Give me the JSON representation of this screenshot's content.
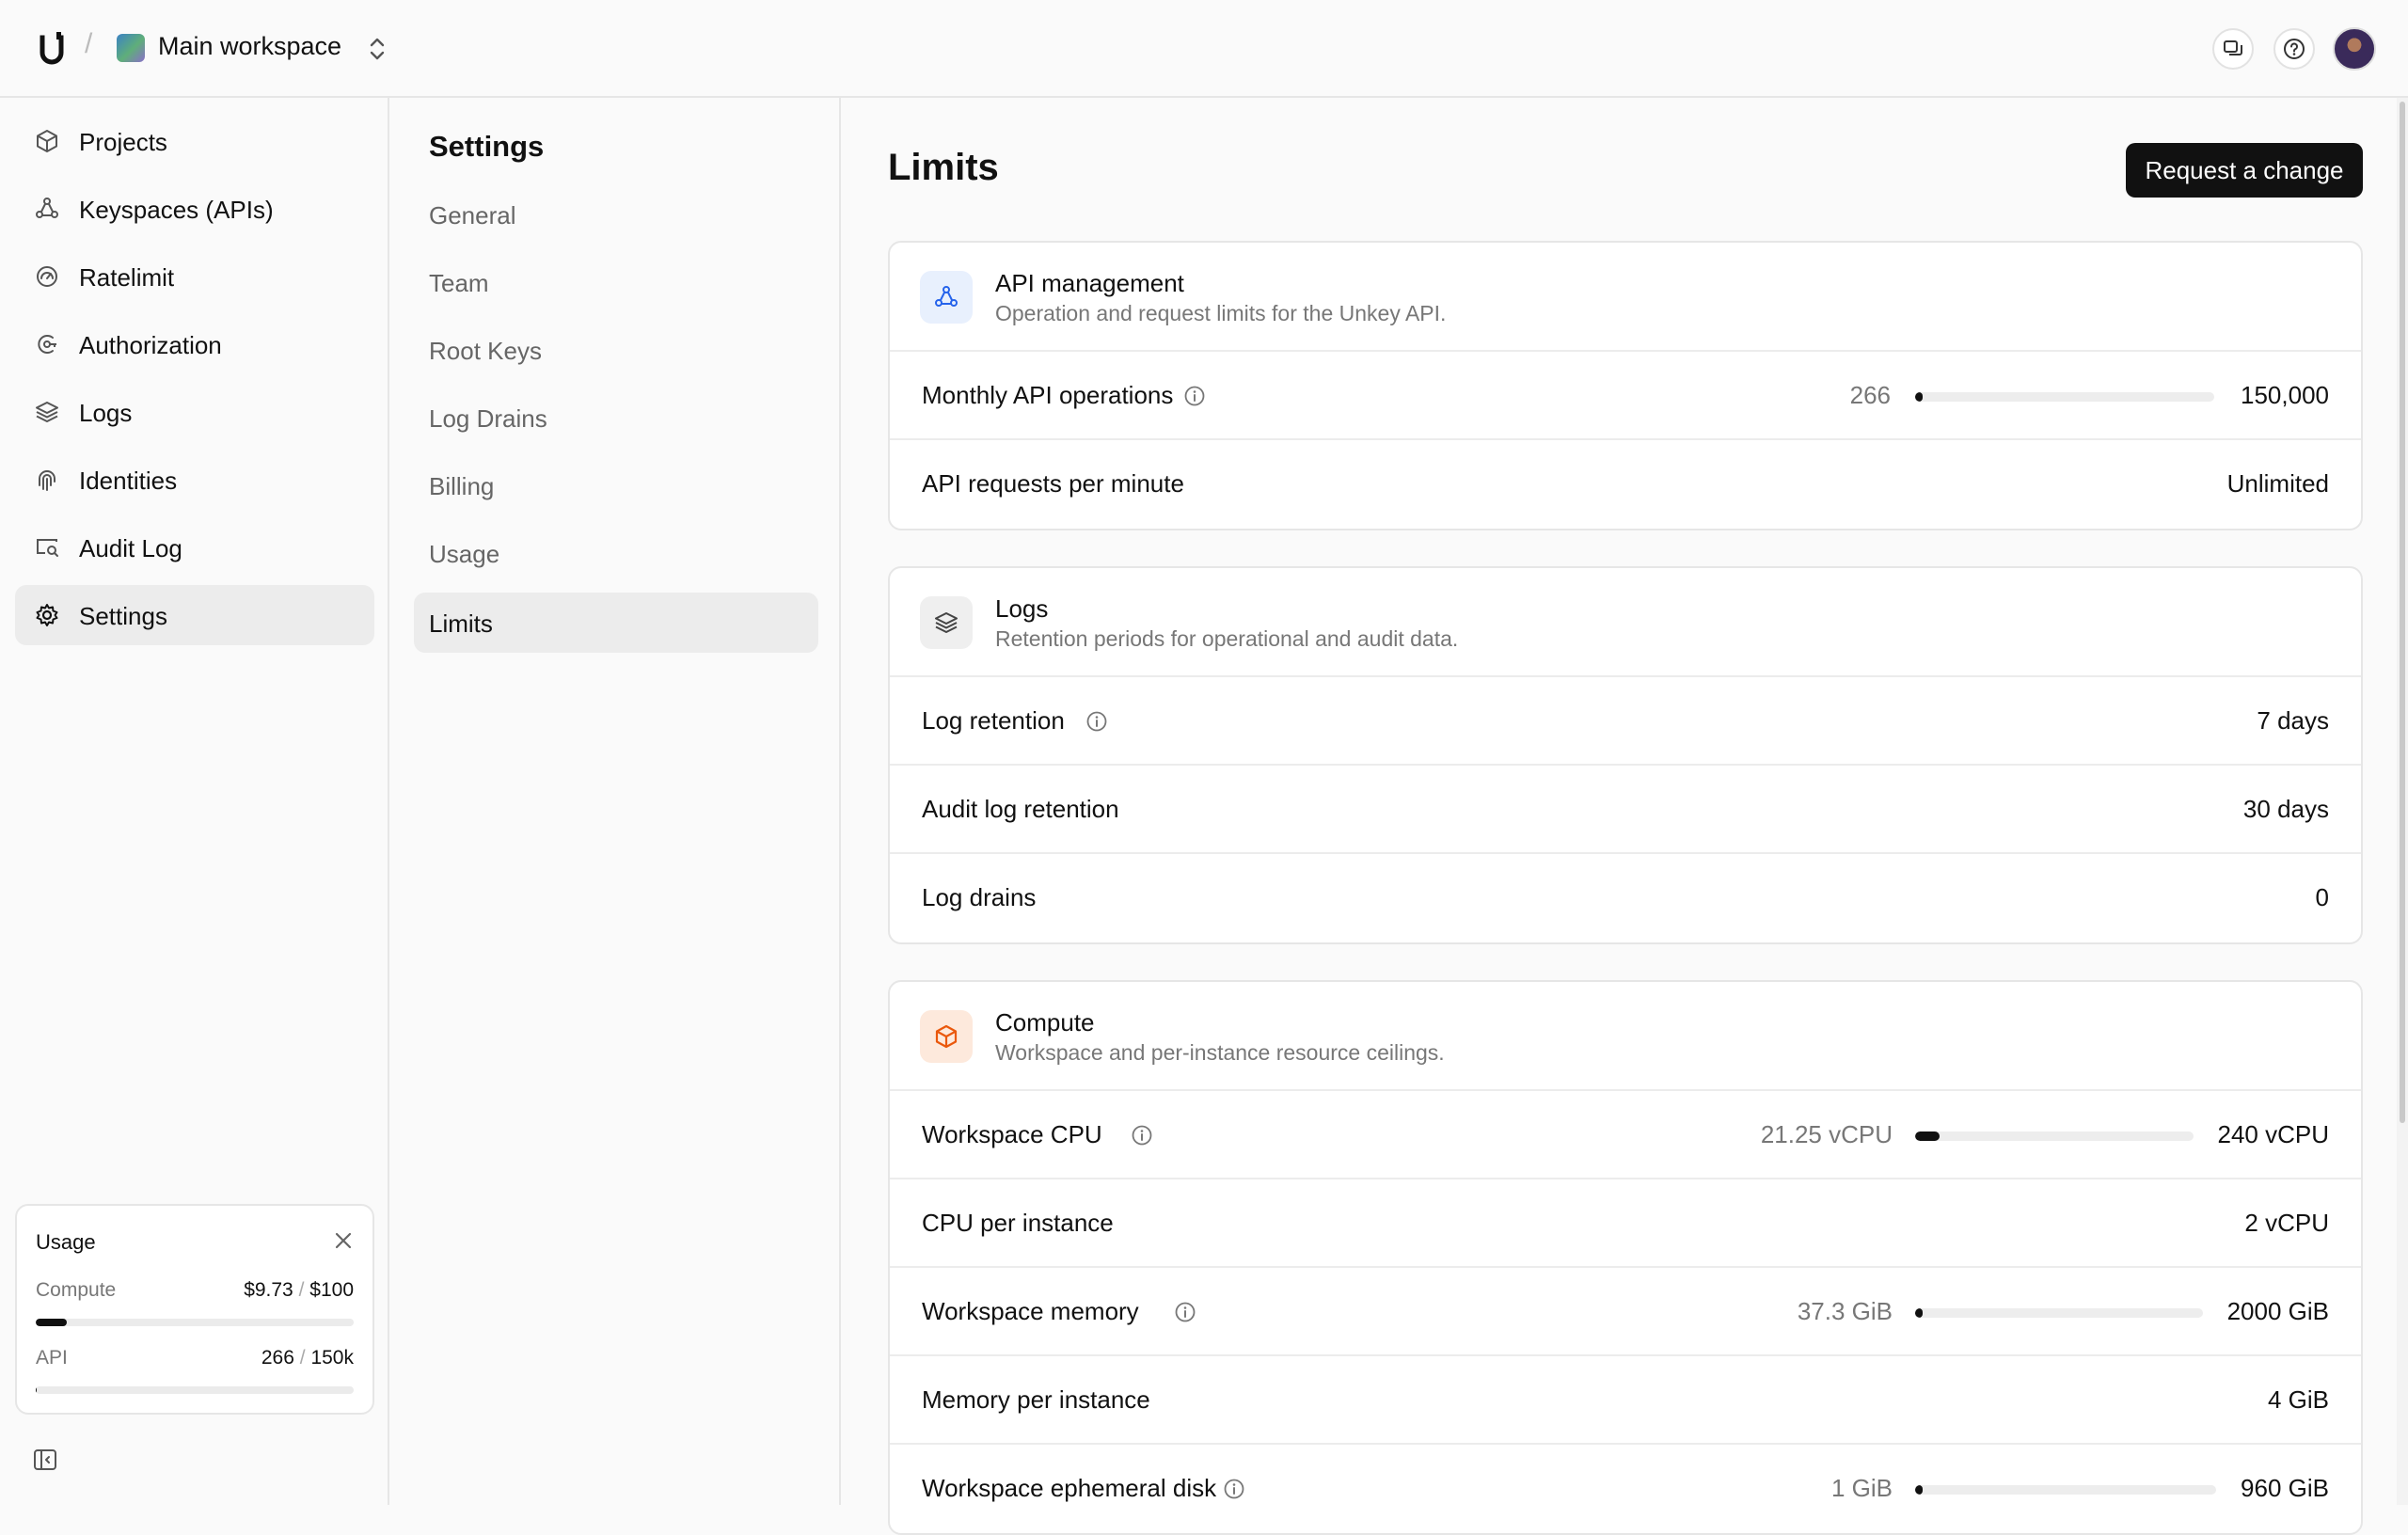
{
  "topbar": {
    "separator": "/",
    "workspace_name": "Main workspace"
  },
  "sidebar": {
    "items": [
      {
        "label": "Projects",
        "icon": "cube-icon"
      },
      {
        "label": "Keyspaces (APIs)",
        "icon": "nodes-icon"
      },
      {
        "label": "Ratelimit",
        "icon": "gauge-icon"
      },
      {
        "label": "Authorization",
        "icon": "shield-key-icon"
      },
      {
        "label": "Logs",
        "icon": "layers-icon"
      },
      {
        "label": "Identities",
        "icon": "fingerprint-icon"
      },
      {
        "label": "Audit Log",
        "icon": "search-log-icon"
      },
      {
        "label": "Settings",
        "icon": "gear-icon",
        "active": true
      }
    ],
    "usage": {
      "title": "Usage",
      "compute": {
        "label": "Compute",
        "used": "$9.73",
        "limit": "$100",
        "fraction": 0.0973
      },
      "api": {
        "label": "API",
        "used": "266",
        "limit": "150k",
        "fraction": 0.0018
      }
    }
  },
  "settings_nav": {
    "title": "Settings",
    "items": [
      {
        "label": "General"
      },
      {
        "label": "Team"
      },
      {
        "label": "Root Keys"
      },
      {
        "label": "Log Drains"
      },
      {
        "label": "Billing"
      },
      {
        "label": "Usage"
      },
      {
        "label": "Limits",
        "active": true
      }
    ]
  },
  "main": {
    "title": "Limits",
    "request_button": "Request a change",
    "sections": {
      "api": {
        "title": "API management",
        "subtitle": "Operation and request limits for the Unkey API.",
        "accent": "#2563eb",
        "rows": {
          "monthly_ops": {
            "label": "Monthly API operations",
            "current": "266",
            "limit": "150,000",
            "fraction": 0.0018
          },
          "rpm": {
            "label": "API requests per minute",
            "value": "Unlimited"
          }
        }
      },
      "logs": {
        "title": "Logs",
        "subtitle": "Retention periods for operational and audit data.",
        "rows": {
          "retention": {
            "label": "Log retention",
            "value": "7 days"
          },
          "audit_retention": {
            "label": "Audit log retention",
            "value": "30 days"
          },
          "drains": {
            "label": "Log drains",
            "value": "0"
          }
        }
      },
      "compute": {
        "title": "Compute",
        "subtitle": "Workspace and per-instance resource ceilings.",
        "accent": "#ea580c",
        "rows": {
          "cpu": {
            "label": "Workspace CPU",
            "current": "21.25 vCPU",
            "limit": "240 vCPU",
            "fraction": 0.0885
          },
          "cpu_instance": {
            "label": "CPU per instance",
            "value": "2 vCPU"
          },
          "memory": {
            "label": "Workspace memory",
            "current": "37.3 GiB",
            "limit": "2000 GiB",
            "fraction": 0.0187
          },
          "memory_instance": {
            "label": "Memory per instance",
            "value": "4 GiB"
          },
          "disk": {
            "label": "Workspace ephemeral disk",
            "current": "1 GiB",
            "limit": "960 GiB",
            "fraction": 0.001
          }
        }
      }
    }
  }
}
